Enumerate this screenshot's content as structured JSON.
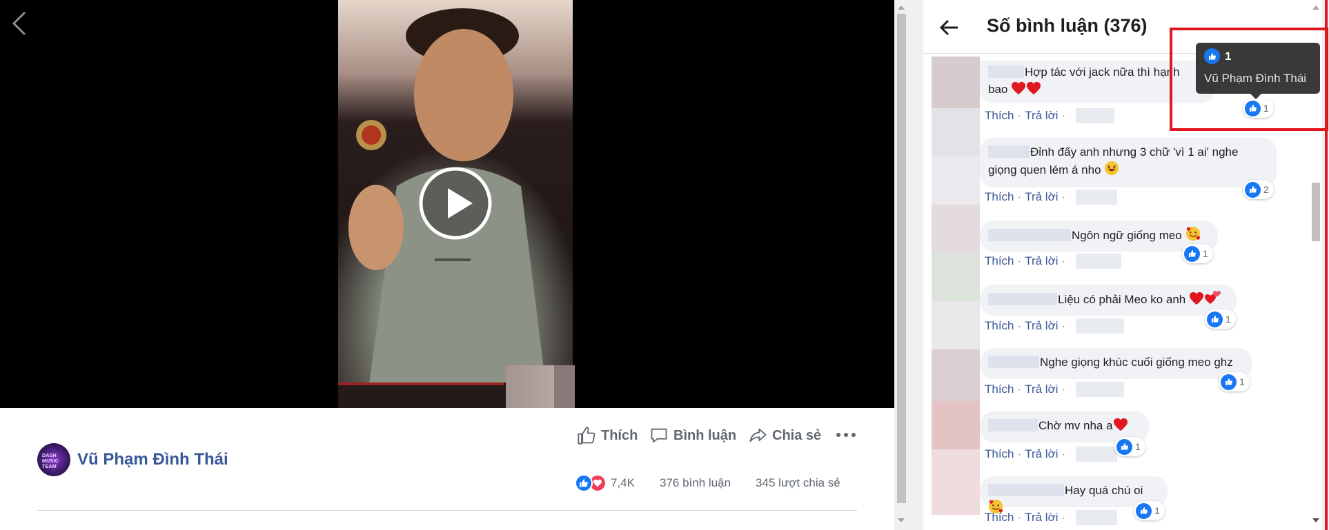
{
  "video": {
    "back_icon": "chevron-left-icon",
    "play_icon": "play-icon"
  },
  "post": {
    "author_name": "Vũ Phạm Đình Thái",
    "author_avatar_text": "DASH MUSIC TEAM",
    "actions": {
      "like_label": "Thích",
      "comment_label": "Bình luận",
      "share_label": "Chia sẻ"
    },
    "stats": {
      "reactions_count": "7,4K",
      "comments_count": "376 bình luận",
      "shares_count": "345 lượt chia sẻ"
    }
  },
  "panel": {
    "title": "Số bình luận (376)",
    "like_label": "Thích",
    "reply_label": "Trả lời",
    "comments": [
      {
        "text_line1": "Hợp tác với jack nữa thì hạnh",
        "text_line2": "bao",
        "reaction_count": "1"
      },
      {
        "text_line1": "Đỉnh đấy anh nhưng 3 chữ 'vì 1 ai' nghe",
        "text_line2": "giọng quen lém á nho",
        "reaction_count": "2"
      },
      {
        "text_line1": "Ngôn ngữ giống meo",
        "reaction_count": "1"
      },
      {
        "text_line1": "Liệu có phải Meo ko anh",
        "reaction_count": "1"
      },
      {
        "text_line1": "Nghe giọng khúc cuối giống meo ghz",
        "reaction_count": "1"
      },
      {
        "text_line1": "Chờ mv nha a",
        "reaction_count": "1"
      },
      {
        "text_line1": "Hay quá chú oi",
        "reaction_count": "1"
      }
    ]
  },
  "tooltip": {
    "count": "1",
    "name": "Vũ Phạm Đình Thái"
  },
  "colors": {
    "link_blue": "#385898",
    "like_blue": "#1877f2",
    "love_red": "#f33e58",
    "highlight_red": "#e0161e"
  }
}
